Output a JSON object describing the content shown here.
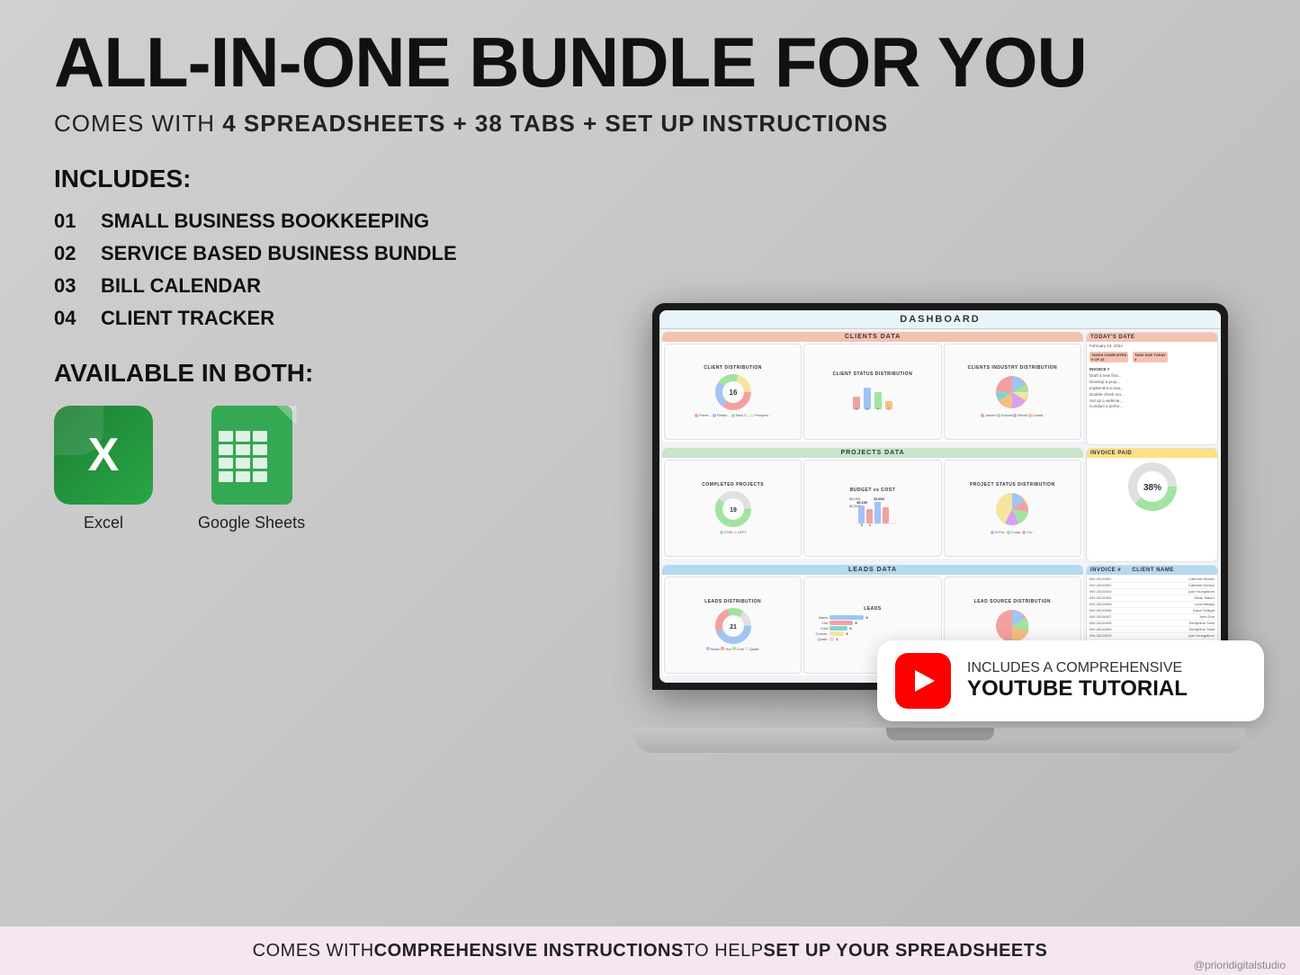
{
  "header": {
    "main_title": "ALL-IN-ONE BUNDLE FOR YOU",
    "subtitle_normal": "COMES WITH  ",
    "subtitle_bold": "4 SPREADSHEETS + 38 TABS + SET UP INSTRUCTIONS"
  },
  "includes": {
    "title": "INCLUDES:",
    "items": [
      {
        "num": "01",
        "label": "SMALL BUSINESS BOOKKEEPING"
      },
      {
        "num": "02",
        "label": "SERVICE BASED BUSINESS BUNDLE"
      },
      {
        "num": "03",
        "label": "BILL CALENDAR"
      },
      {
        "num": "04",
        "label": "CLIENT TRACKER"
      }
    ]
  },
  "available": {
    "title": "AVAILABLE IN BOTH:",
    "excel_label": "Excel",
    "sheets_label": "Google Sheets"
  },
  "dashboard": {
    "title": "DASHBOARD",
    "clients_section_label": "CLIENTS DATA",
    "projects_section_label": "PROJECTS DATA",
    "leads_section_label": "LEADS DATA",
    "charts": {
      "client_distribution": "CLIENT DISTRIBUTION",
      "client_status": "CLIENT STATUS DISTRIBUTION",
      "clients_industry": "CLIENTS INDUSTRY DISTRIBUTION",
      "completed_projects": "COMPLETED PROJECTS",
      "budget_vs_cost": "BUDGET vs COST",
      "project_status": "PROJECT STATUS DISTRIBUTION",
      "leads_distribution": "LEADS DISTRIBUTION",
      "leads": "LEADS",
      "lead_source": "LEAD SOURCE DISTRIBUTION"
    },
    "client_number": "16",
    "project_number": "19",
    "leads_number": "21",
    "invoice_paid_pct": "38%",
    "todays_date_label": "TODAY'S DATE",
    "todays_date": "February 24, 2024",
    "tasks_completed_label": "TASKS COMPLETED",
    "tasks_completed": "9 OF 23",
    "task_due_label": "TASK DUE TODAY",
    "task_due_val": "4",
    "invoice_paid_label": "INVOICE PAID",
    "invoice_list_label": "INVOICE #",
    "client_name_label": "CLIENT NAME"
  },
  "youtube": {
    "text_top": "INCLUDES A COMPREHENSIVE",
    "text_bottom": "YOUTUBE TUTORIAL"
  },
  "bottom_bar": {
    "text_before": "COMES WITH ",
    "text_bold1": "COMPREHENSIVE INSTRUCTIONS",
    "text_mid": " TO HELP ",
    "text_bold2": "SET UP YOUR SPREADSHEETS"
  },
  "watermark": "@prioridigitalstudio",
  "colors": {
    "pink_pie": "#f4a0a0",
    "blue_pie": "#a0c4f4",
    "green_pie": "#a0e4a0",
    "yellow_pie": "#f4e4a0",
    "purple_pie": "#d4a0f4",
    "orange_pie": "#f4c080",
    "teal_pie": "#80d4d4",
    "accent_pink": "#f4c2b0"
  }
}
